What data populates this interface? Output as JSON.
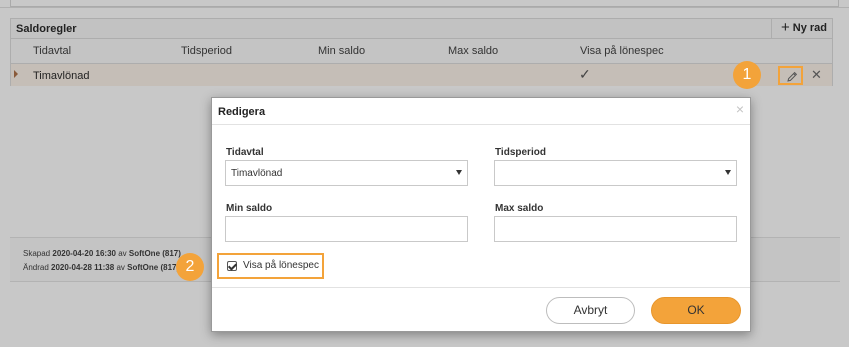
{
  "panel": {
    "title": "Saldoregler",
    "add_label": "Ny rad",
    "columns": [
      "Tidavtal",
      "Tidsperiod",
      "Min saldo",
      "Max saldo",
      "Visa på lönespec"
    ],
    "row": {
      "tidavtal": "Timavlönad",
      "visa_checked": true
    }
  },
  "badges": {
    "one": "1",
    "two": "2"
  },
  "footer": {
    "created_label": "Skapad",
    "created_date": "2020-04-20 16:30",
    "created_by_label": "av",
    "created_by": "SoftOne (817)",
    "changed_label": "Ändrad",
    "changed_date": "2020-04-28 11:38",
    "changed_by_label": "av",
    "changed_by": "SoftOne (817)"
  },
  "dialog": {
    "title": "Redigera",
    "close_icon": "×",
    "tidavtal_label": "Tidavtal",
    "tidavtal_value": "Timavlönad",
    "tidsperiod_label": "Tidsperiod",
    "tidsperiod_value": "",
    "min_saldo_label": "Min saldo",
    "min_saldo_value": "",
    "max_saldo_label": "Max saldo",
    "max_saldo_value": "",
    "visa_label": "Visa på lönespec",
    "visa_checked": true,
    "cancel_label": "Avbryt",
    "ok_label": "OK"
  },
  "colors": {
    "accent": "#f3a33a",
    "overlay": "#c8c8c8"
  }
}
